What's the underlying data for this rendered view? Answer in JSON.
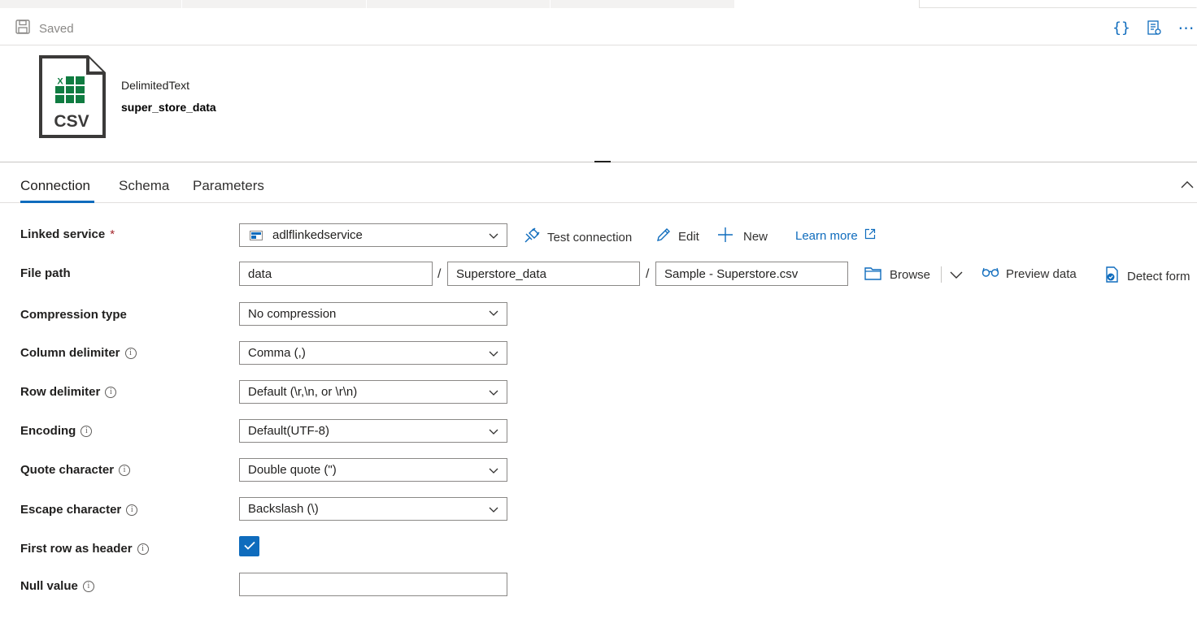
{
  "toolbar": {
    "saved_label": "Saved",
    "icons": [
      "code-braces-icon",
      "properties-icon",
      "more-icon"
    ]
  },
  "dataset": {
    "type": "DelimitedText",
    "name": "super_store_data",
    "icon_text": "CSV",
    "icon_excel_letter": "X"
  },
  "tabs": [
    {
      "label": "Connection",
      "active": true
    },
    {
      "label": "Schema",
      "active": false
    },
    {
      "label": "Parameters",
      "active": false
    }
  ],
  "form": {
    "linked_service": {
      "label": "Linked service",
      "required_mark": "*",
      "value": "adlflinkedservice"
    },
    "actions": {
      "test_connection": "Test connection",
      "edit": "Edit",
      "new": "New",
      "learn_more": "Learn more"
    },
    "file_path": {
      "label": "File path",
      "container": "data",
      "directory": "Superstore_data",
      "file": "Sample - Superstore.csv",
      "separator": "/",
      "browse": "Browse",
      "preview": "Preview data",
      "detect": "Detect form"
    },
    "compression_type": {
      "label": "Compression type",
      "value": "No compression"
    },
    "column_delimiter": {
      "label": "Column delimiter",
      "value": "Comma (,)"
    },
    "row_delimiter": {
      "label": "Row delimiter",
      "value": "Default (\\r,\\n, or \\r\\n)"
    },
    "encoding": {
      "label": "Encoding",
      "value": "Default(UTF-8)"
    },
    "quote_character": {
      "label": "Quote character",
      "value": "Double quote (\")"
    },
    "escape_character": {
      "label": "Escape character",
      "value": "Backslash (\\)"
    },
    "first_row_header": {
      "label": "First row as header",
      "checked": true
    },
    "null_value": {
      "label": "Null value",
      "value": ""
    }
  },
  "colors": {
    "accent": "#0f6cbd",
    "required": "#a4262c",
    "excel_green": "#107c41"
  }
}
